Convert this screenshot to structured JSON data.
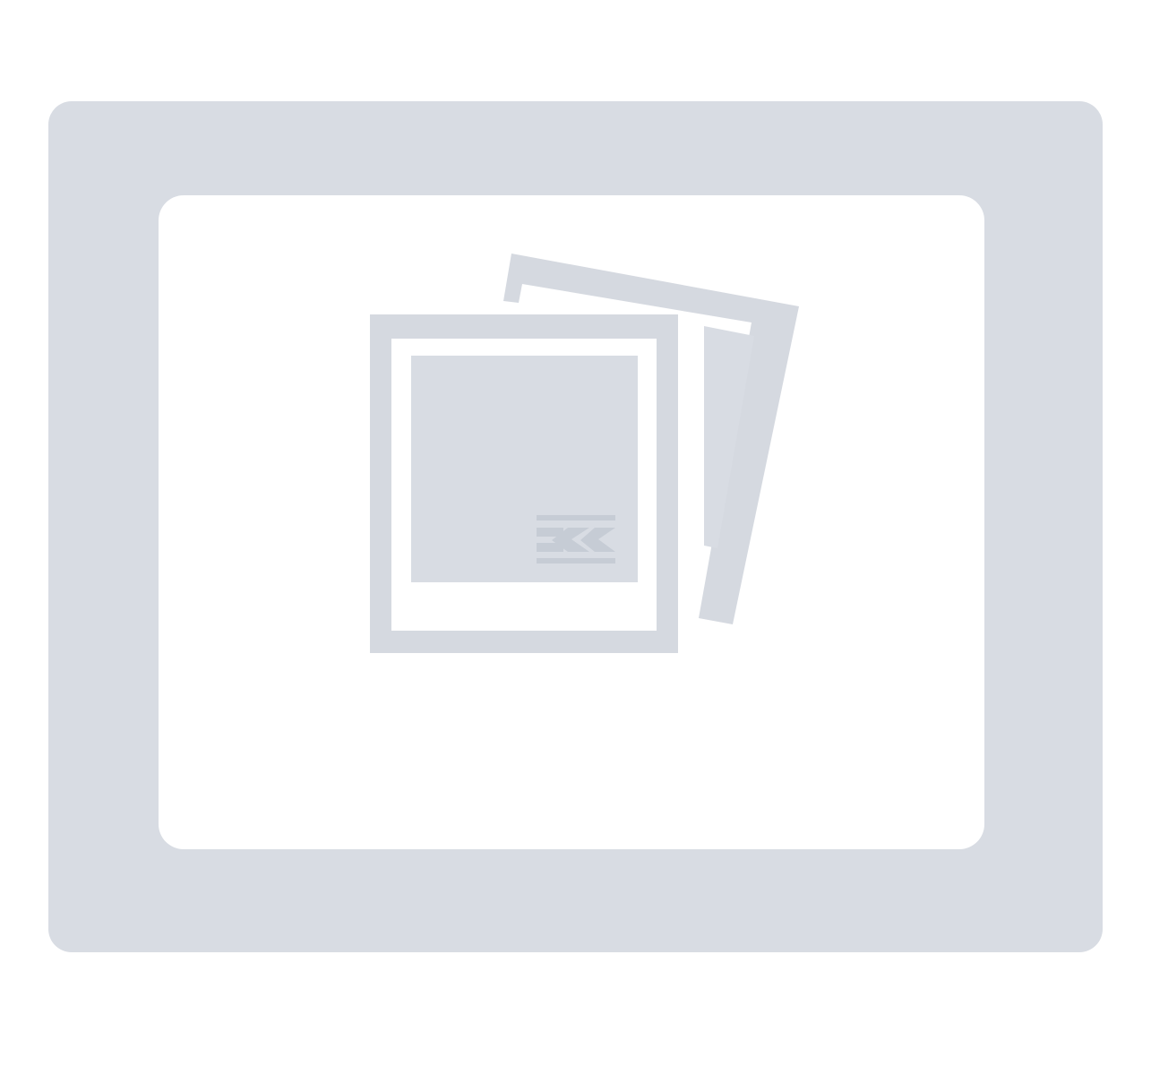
{
  "placeholder": {
    "icon": "image-placeholder-icon",
    "watermark_icon": "k-logo-icon"
  },
  "colors": {
    "frame": "#d8dce3",
    "panel": "#ffffff",
    "photo_border": "#d5d9e0",
    "photo_fill": "#d8dce3",
    "watermark": "#c6ccd5"
  }
}
